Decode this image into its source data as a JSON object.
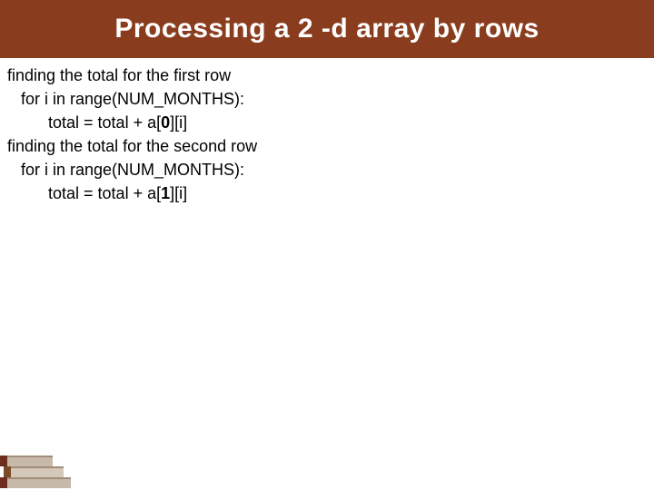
{
  "title": "Processing a 2 -d array by rows",
  "lines": {
    "l0": "finding the total for the first row",
    "l1": "   for i in range(NUM_MONTHS):",
    "l2a": "         total = total + a[",
    "l2b": "0",
    "l2c": "][i]",
    "l3": "finding the total for the second row",
    "l4": "   for i in range(NUM_MONTHS):",
    "l5a": "         total = total + a[",
    "l5b": "1",
    "l5c": "][i]"
  },
  "colors": {
    "title_bg": "#8a3d1e",
    "title_fg": "#ffffff",
    "book_brown": "#7a4a2a",
    "book_maroon": "#6e2e1f",
    "book_shadow": "#c7b9aa"
  }
}
